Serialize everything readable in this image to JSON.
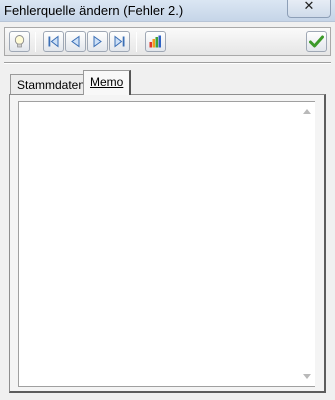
{
  "window": {
    "title": "Fehlerquelle ändern (Fehler 2.)",
    "close_glyph": "✕"
  },
  "toolbar": {
    "buttons": [
      {
        "name": "hint-button",
        "icon": "lightbulb-icon"
      },
      {
        "name": "first-record-button",
        "icon": "first-icon"
      },
      {
        "name": "previous-record-button",
        "icon": "previous-icon"
      },
      {
        "name": "next-record-button",
        "icon": "next-icon"
      },
      {
        "name": "last-record-button",
        "icon": "last-icon"
      },
      {
        "name": "chart-button",
        "icon": "bar-chart-icon"
      },
      {
        "name": "confirm-button",
        "icon": "checkmark-icon"
      }
    ]
  },
  "tabs": [
    {
      "label": "Stammdaten",
      "active": false
    },
    {
      "label": "Memo",
      "active": true
    }
  ],
  "memo": {
    "value": ""
  },
  "colors": {
    "accent_blue": "#3b6fb6",
    "confirm_green": "#3c9a2a"
  }
}
